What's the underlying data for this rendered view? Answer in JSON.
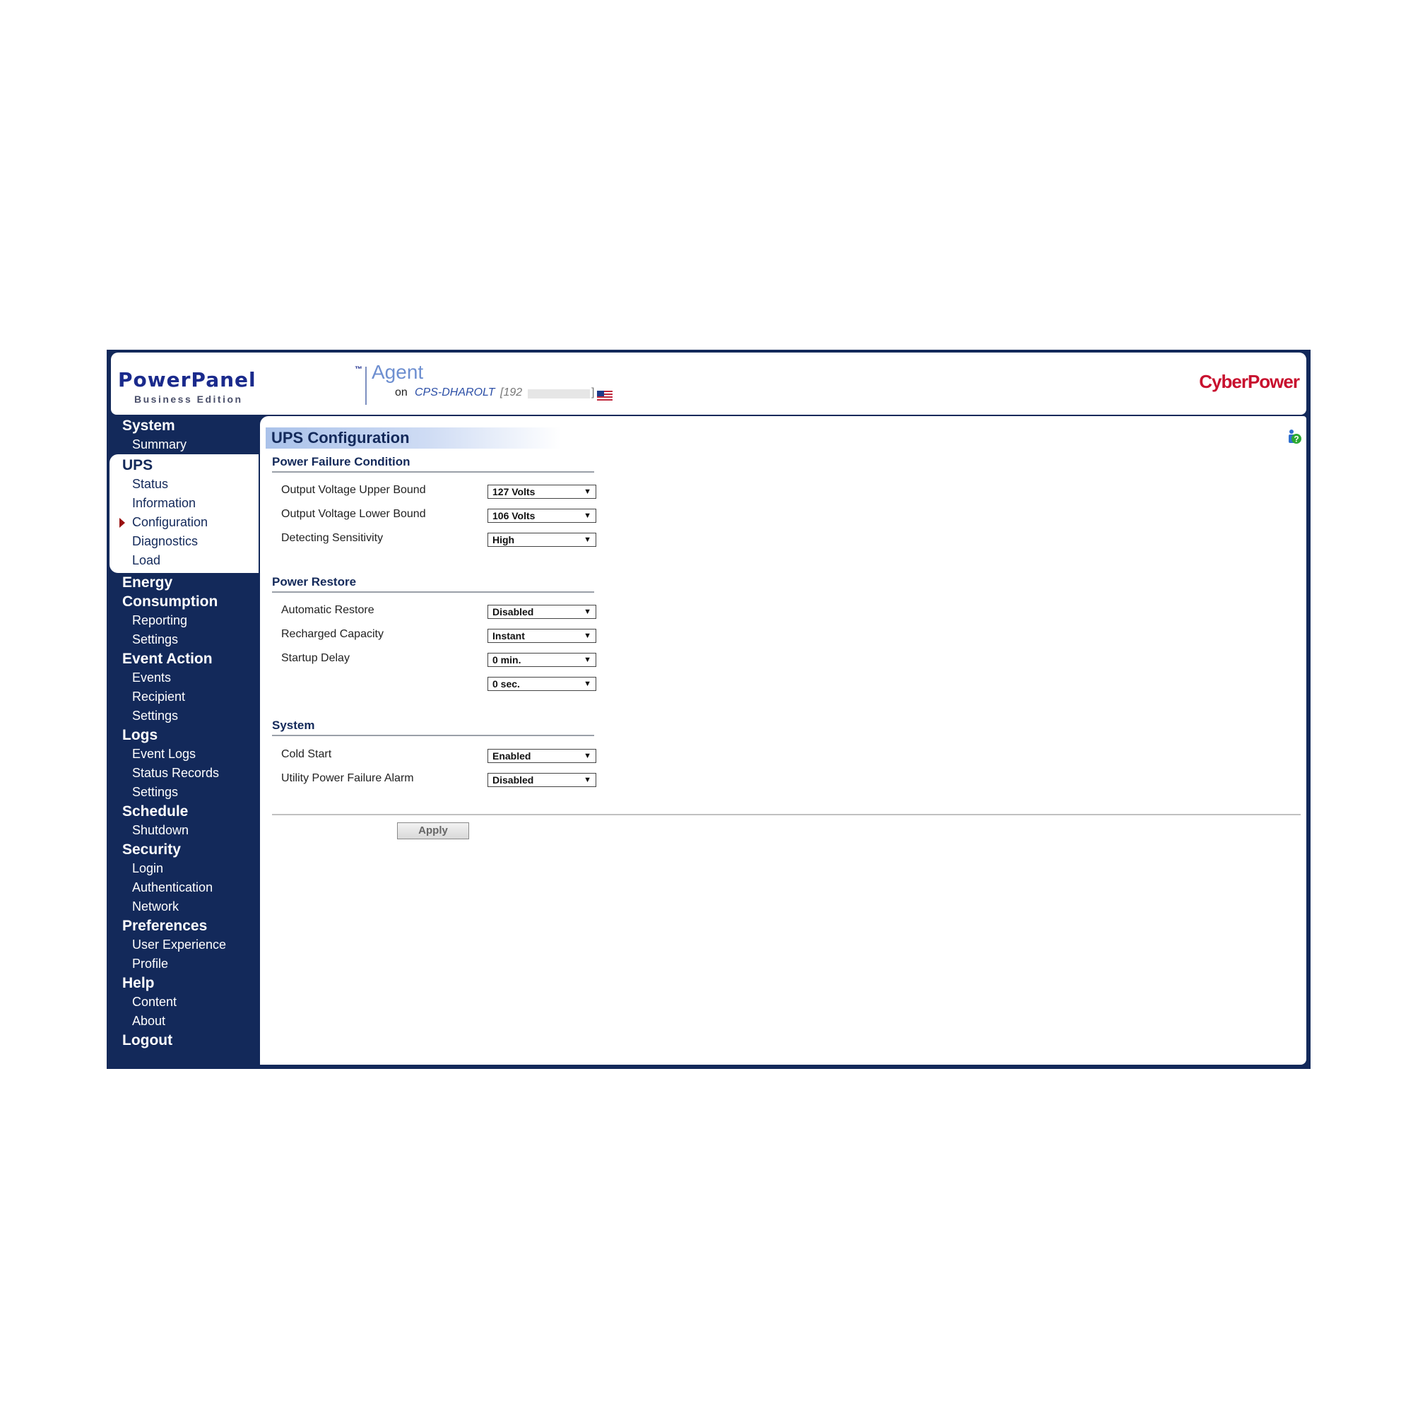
{
  "header": {
    "logo_main": "PowerPanel",
    "logo_tm": "™",
    "logo_edition": "Business Edition",
    "agent": "Agent",
    "on": "on",
    "host": "CPS-DHAROLT",
    "ip_prefix": "[192",
    "ip_suffix": "]",
    "brand": "CyberPower"
  },
  "sidebar": {
    "system": "System",
    "summary": "Summary",
    "ups": "UPS",
    "status": "Status",
    "information": "Information",
    "configuration": "Configuration",
    "diagnostics": "Diagnostics",
    "load": "Load",
    "energy": "Energy",
    "consumption": "Consumption",
    "reporting": "Reporting",
    "energy_settings": "Settings",
    "event_action": "Event Action",
    "events": "Events",
    "recipient": "Recipient",
    "event_settings": "Settings",
    "logs": "Logs",
    "event_logs": "Event Logs",
    "status_records": "Status Records",
    "logs_settings": "Settings",
    "schedule": "Schedule",
    "shutdown": "Shutdown",
    "security": "Security",
    "login": "Login",
    "authentication": "Authentication",
    "network": "Network",
    "preferences": "Preferences",
    "user_experience": "User Experience",
    "profile": "Profile",
    "help": "Help",
    "content": "Content",
    "about": "About",
    "logout": "Logout"
  },
  "main": {
    "title": "UPS Configuration",
    "power_failure": {
      "title": "Power Failure Condition",
      "upper_label": "Output Voltage Upper Bound",
      "upper_value": "127 Volts",
      "lower_label": "Output Voltage Lower Bound",
      "lower_value": "106 Volts",
      "sensitivity_label": "Detecting Sensitivity",
      "sensitivity_value": "High"
    },
    "power_restore": {
      "title": "Power Restore",
      "auto_label": "Automatic Restore",
      "auto_value": "Disabled",
      "recharged_label": "Recharged Capacity",
      "recharged_value": "Instant",
      "delay_label": "Startup Delay",
      "delay_min": "0 min.",
      "delay_sec": "0 sec."
    },
    "system": {
      "title": "System",
      "cold_label": "Cold Start",
      "cold_value": "Enabled",
      "alarm_label": "Utility Power Failure Alarm",
      "alarm_value": "Disabled"
    },
    "apply": "Apply",
    "caret": "▼"
  }
}
